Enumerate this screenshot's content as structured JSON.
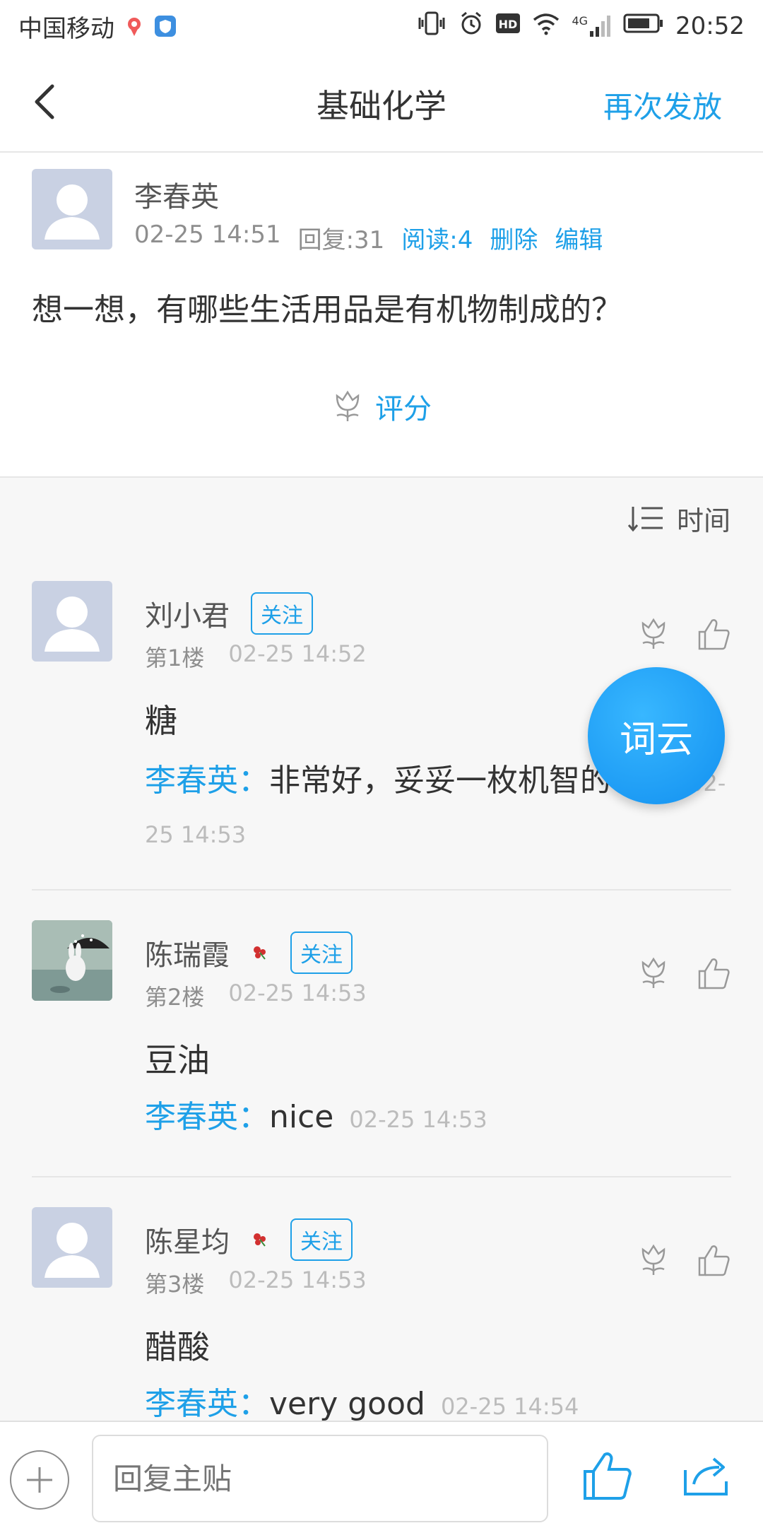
{
  "status_bar": {
    "carrier": "中国移动",
    "network": "4G",
    "time": "20:52"
  },
  "header": {
    "title": "基础化学",
    "action": "再次发放"
  },
  "post": {
    "author": "李春英",
    "date": "02-25 14:51",
    "replies": "回复:31",
    "reads": "阅读:4",
    "delete_label": "删除",
    "edit_label": "编辑",
    "content": "想一想，有哪些生活用品是有机物制成的？",
    "rate_label": "评分"
  },
  "sort": {
    "label": "时间"
  },
  "replies": [
    {
      "name": "刘小君",
      "follow": "关注",
      "floor": "第1楼",
      "time": "02-25 14:52",
      "content": "糖",
      "reply_author": "李春英：",
      "reply_text": "非常好，妥妥一枚机智的吃货",
      "reply_time": "02-25 14:53"
    },
    {
      "name": "陈瑞霞",
      "follow": "关注",
      "floor": "第2楼",
      "time": "02-25 14:53",
      "content": "豆油",
      "reply_author": "李春英：",
      "reply_text": "nice",
      "reply_time": "02-25 14:53"
    },
    {
      "name": "陈星均",
      "follow": "关注",
      "floor": "第3楼",
      "time": "02-25 14:53",
      "content": "醋酸",
      "reply_author": "李春英：",
      "reply_text": "very  good",
      "reply_time": "02-25 14:54"
    }
  ],
  "fab": {
    "label": "词云"
  },
  "bottom": {
    "placeholder": "回复主贴"
  },
  "colors": {
    "accent": "#1ea0e8",
    "text": "#333333",
    "muted": "#8e8e8e"
  }
}
